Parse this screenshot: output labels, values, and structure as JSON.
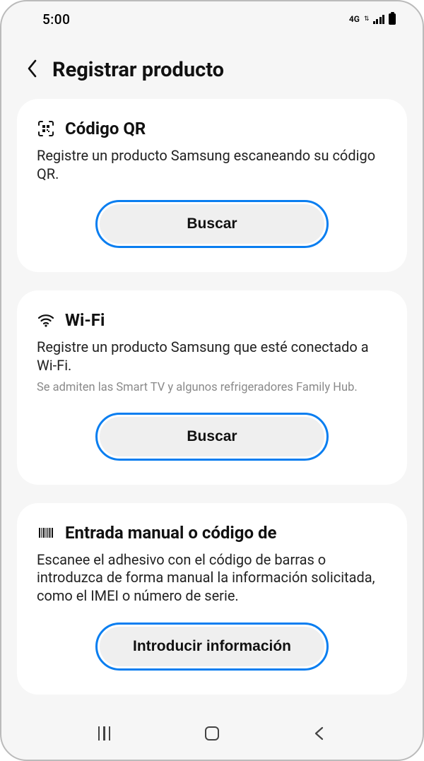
{
  "status": {
    "time": "5:00",
    "network": "4G"
  },
  "header": {
    "title": "Registrar producto"
  },
  "cards": {
    "qr": {
      "title": "Código QR",
      "desc": "Registre un producto Samsung escaneando su código QR.",
      "button": "Buscar"
    },
    "wifi": {
      "title": "Wi-Fi",
      "desc": "Registre un producto Samsung que esté conectado a Wi-Fi.",
      "sub": "Se admiten las Smart TV y algunos refrigeradores Family Hub.",
      "button": "Buscar"
    },
    "manual": {
      "title": "Entrada manual o código de",
      "desc": "Escanee el adhesivo con el código de barras o introduzca de forma manual la información solicitada, como el IMEI o número de serie.",
      "button": "Introducir información"
    }
  }
}
